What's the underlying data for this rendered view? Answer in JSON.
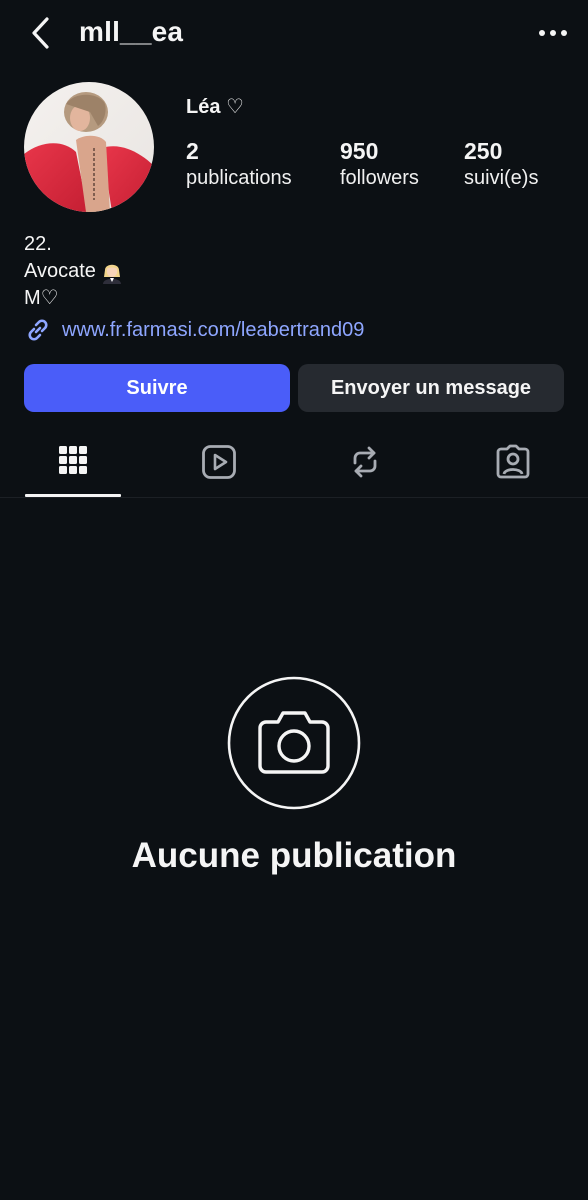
{
  "header": {
    "username": "mll__ea",
    "back_icon": "chevron-left-icon",
    "more_icon": "more-horizontal-icon"
  },
  "profile": {
    "display_name": "Léa ♡",
    "stats": [
      {
        "value": "2",
        "label": "publications"
      },
      {
        "value": "950",
        "label": "followers"
      },
      {
        "value": "250",
        "label": "suivi(e)s"
      }
    ],
    "bio": {
      "line1": "22.",
      "line2": "Avocate",
      "line2_emoji": "woman-judge-emoji",
      "line3": "M♡"
    },
    "link": "www.fr.farmasi.com/leabertrand09"
  },
  "actions": {
    "follow_label": "Suivre",
    "message_label": "Envoyer un message"
  },
  "tabs": [
    {
      "icon": "grid-icon",
      "active": true
    },
    {
      "icon": "reels-icon",
      "active": false
    },
    {
      "icon": "repost-icon",
      "active": false
    },
    {
      "icon": "tagged-icon",
      "active": false
    }
  ],
  "empty_state": {
    "icon": "camera-icon",
    "title": "Aucune publication"
  },
  "colors": {
    "background": "#0c1014",
    "accent": "#4a5df9",
    "link": "#8ea6ff",
    "secondary_button": "#262a30"
  }
}
